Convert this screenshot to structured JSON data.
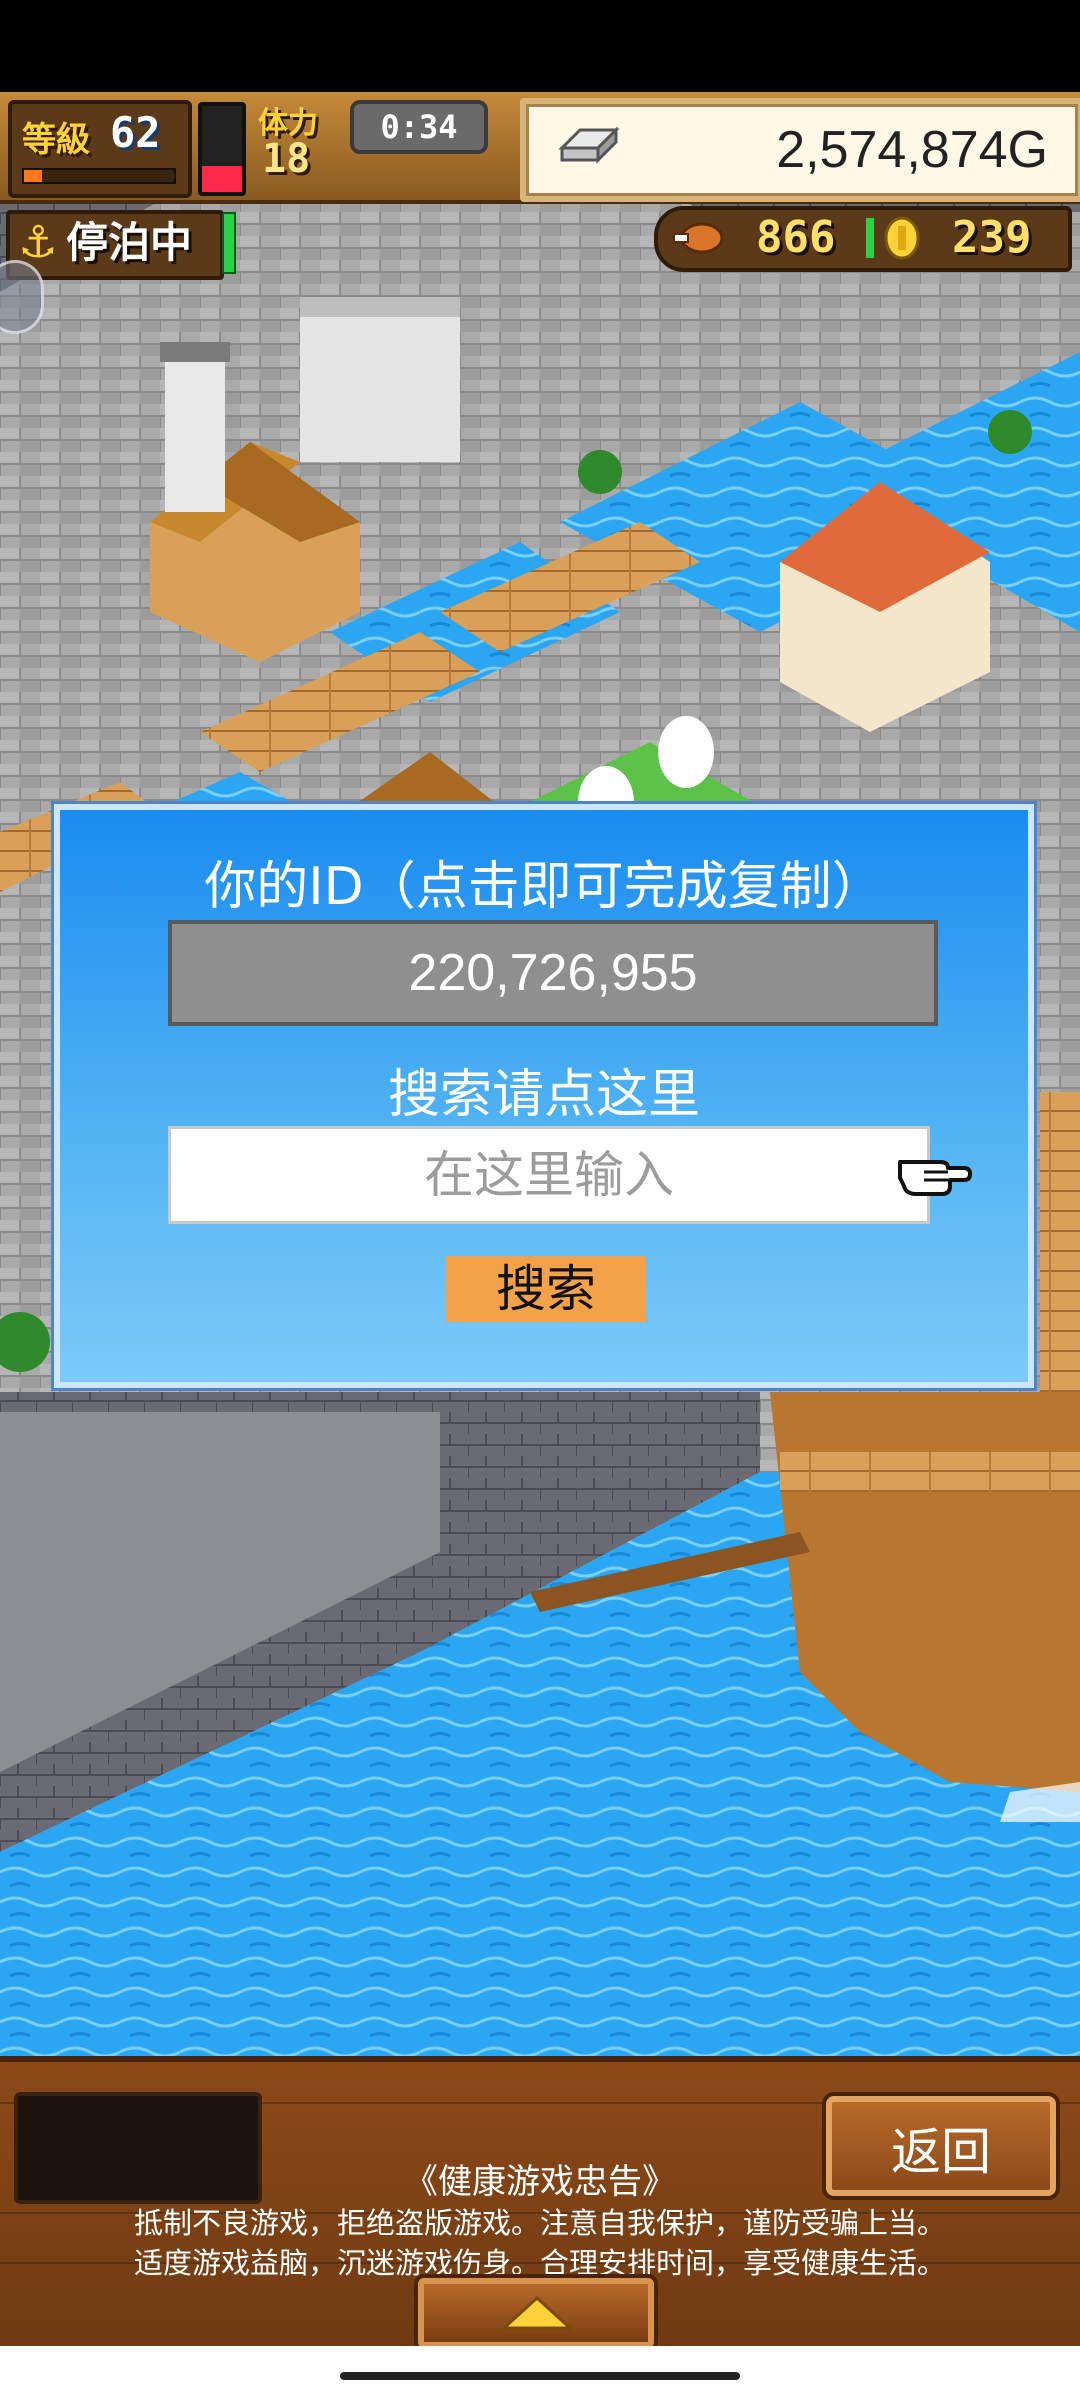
{
  "hud": {
    "level_label": "等級",
    "level_value": "62",
    "level_progress": 0.12,
    "stamina_label": "体力",
    "stamina_value": "18",
    "stamina_level": 0.3,
    "timer": "0:34",
    "gold": "2,574,874G",
    "gold_icon": "silver-ingot-icon",
    "port_status": "停泊中",
    "food_icon": "roast-meat-icon",
    "food": "866",
    "coin_icon": "gold-coin-icon",
    "coins": "239"
  },
  "dialog": {
    "title": "你的ID（点击即可完成复制）",
    "id_value": "220,726,955",
    "search_label": "搜索请点这里",
    "search_placeholder": "在这里输入",
    "search_value": "",
    "search_button": "搜索",
    "pointer_icon": "pointing-hand-icon"
  },
  "bottom": {
    "back_button": "返回",
    "advisory_title": "《健康游戏忠告》",
    "advisory_line1": "抵制不良游戏，拒绝盗版游戏。注意自我保护，谨防受骗上当。",
    "advisory_line2": "适度游戏益脑，沉迷游戏伤身。合理安排时间，享受健康生活。",
    "up_icon": "triangle-up-icon"
  },
  "colors": {
    "dialog_blue": "#1a8cf0",
    "search_button": "#f4a24a",
    "water": "#2aa0f0",
    "wood": "#8c4a18"
  }
}
